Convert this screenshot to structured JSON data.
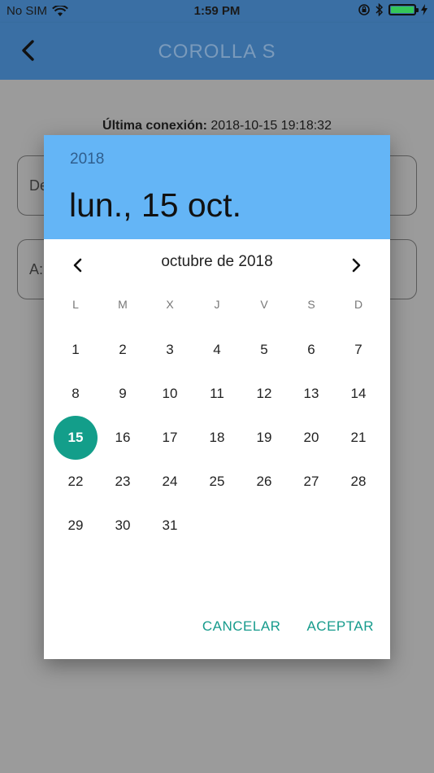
{
  "status": {
    "carrier": "No SIM",
    "time": "1:59 PM"
  },
  "nav": {
    "title": "COROLLA  S"
  },
  "background": {
    "last_connection_label": "Última conexión:",
    "last_connection_value": "2018-10-15 19:18:32",
    "field_from_placeholder": "De",
    "field_to_placeholder": "A:"
  },
  "dialog": {
    "year": "2018",
    "date_display": "lun., 15 oct.",
    "month_label": "octubre de 2018",
    "weekdays": [
      "L",
      "M",
      "X",
      "J",
      "V",
      "S",
      "D"
    ],
    "days": [
      "1",
      "2",
      "3",
      "4",
      "5",
      "6",
      "7",
      "8",
      "9",
      "10",
      "11",
      "12",
      "13",
      "14",
      "15",
      "16",
      "17",
      "18",
      "19",
      "20",
      "21",
      "22",
      "23",
      "24",
      "25",
      "26",
      "27",
      "28",
      "29",
      "30",
      "31"
    ],
    "selected_day": "15",
    "cancel_label": "CANCELAR",
    "accept_label": "ACEPTAR"
  },
  "colors": {
    "header_bg": "#64b5f6",
    "nav_bg": "#3a6fa4",
    "accent": "#139e8a"
  }
}
